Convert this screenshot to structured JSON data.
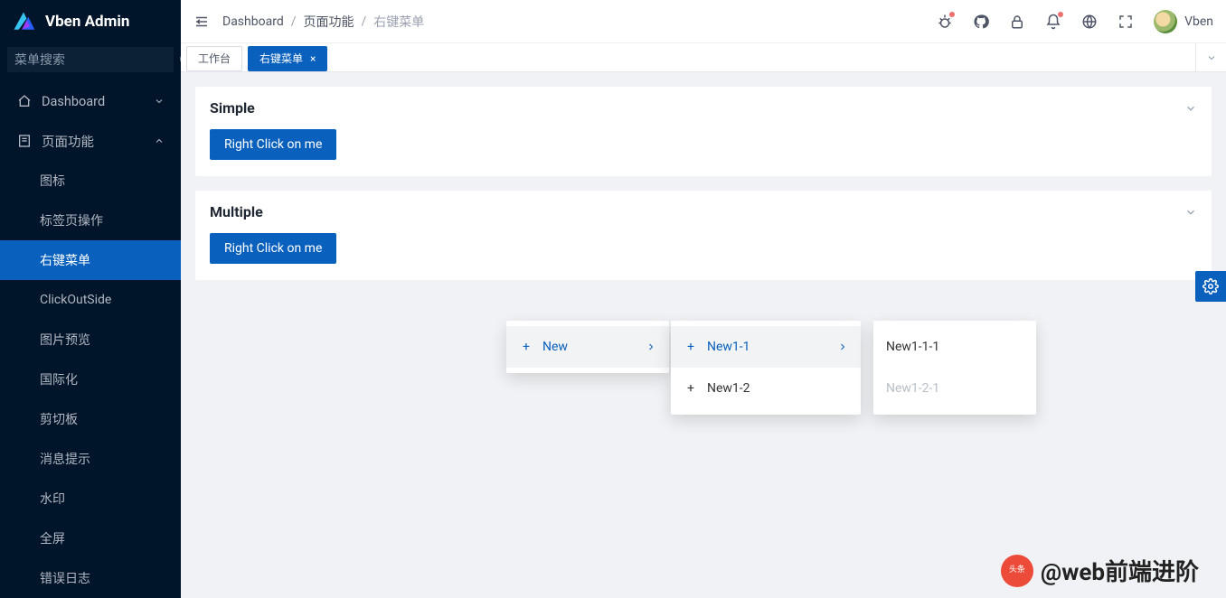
{
  "app": {
    "name": "Vben Admin",
    "user": "Vben"
  },
  "search": {
    "placeholder": "菜单搜索"
  },
  "sidebar": {
    "dashboard": "Dashboard",
    "features": "页面功能",
    "items": [
      "图标",
      "标签页操作",
      "右键菜单",
      "ClickOutSide",
      "图片预览",
      "国际化",
      "剪切板",
      "消息提示",
      "水印",
      "全屏",
      "错误日志"
    ]
  },
  "breadcrumb": {
    "a": "Dashboard",
    "b": "页面功能",
    "c": "右键菜单"
  },
  "tabs": {
    "workspace": "工作台",
    "context": "右键菜单"
  },
  "cards": {
    "simple": {
      "title": "Simple",
      "btn": "Right Click on me"
    },
    "multiple": {
      "title": "Multiple",
      "btn": "Right Click on me"
    }
  },
  "ctx": {
    "l1": {
      "new": "New"
    },
    "l2": {
      "a": "New1-1",
      "b": "New1-2"
    },
    "l3": {
      "a": "New1-1-1",
      "b": "New1-2-1"
    }
  },
  "watermark": {
    "badge": "头条",
    "text": "@web前端进阶"
  }
}
